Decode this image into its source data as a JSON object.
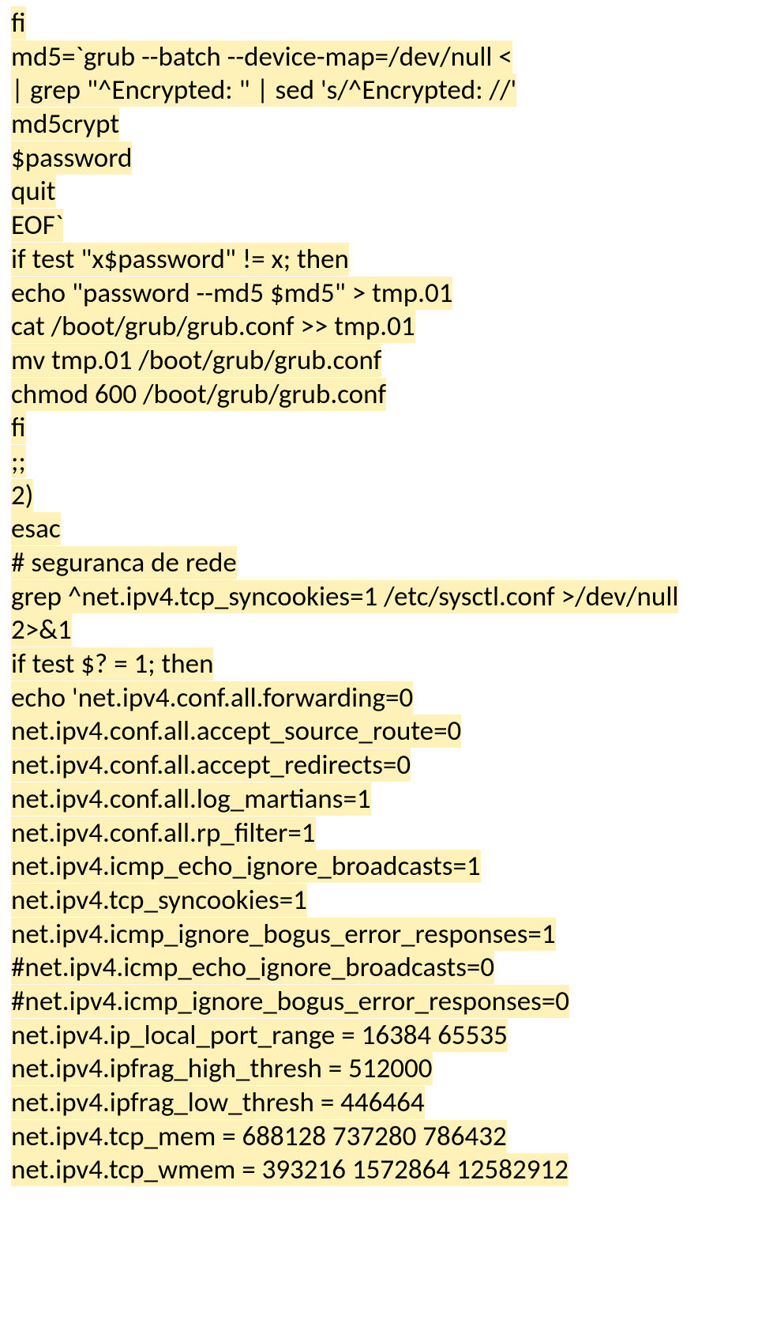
{
  "lines": [
    "fi",
    "md5=`grub --batch --device-map=/dev/null <",
    "| grep \"^Encrypted: \" | sed 's/^Encrypted: //'",
    "md5crypt",
    "$password",
    "quit",
    "EOF`",
    "if test \"x$password\" != x; then",
    "echo \"password --md5 $md5\" > tmp.01",
    "cat /boot/grub/grub.conf >> tmp.01",
    "mv tmp.01 /boot/grub/grub.conf",
    "chmod 600 /boot/grub/grub.conf",
    "fi",
    ";;",
    "2)",
    "esac",
    "# seguranca de rede",
    "grep ^net.ipv4.tcp_syncookies=1 /etc/sysctl.conf >/dev/null",
    "2>&1",
    "if test $? = 1; then",
    "echo 'net.ipv4.conf.all.forwarding=0",
    "net.ipv4.conf.all.accept_source_route=0",
    "net.ipv4.conf.all.accept_redirects=0",
    "net.ipv4.conf.all.log_martians=1",
    "net.ipv4.conf.all.rp_filter=1",
    "net.ipv4.icmp_echo_ignore_broadcasts=1",
    "net.ipv4.tcp_syncookies=1",
    "net.ipv4.icmp_ignore_bogus_error_responses=1",
    "#net.ipv4.icmp_echo_ignore_broadcasts=0",
    "#net.ipv4.icmp_ignore_bogus_error_responses=0",
    "net.ipv4.ip_local_port_range = 16384 65535",
    "net.ipv4.ipfrag_high_thresh = 512000",
    "net.ipv4.ipfrag_low_thresh = 446464",
    "net.ipv4.tcp_mem = 688128 737280 786432",
    "net.ipv4.tcp_wmem = 393216 1572864 12582912"
  ]
}
